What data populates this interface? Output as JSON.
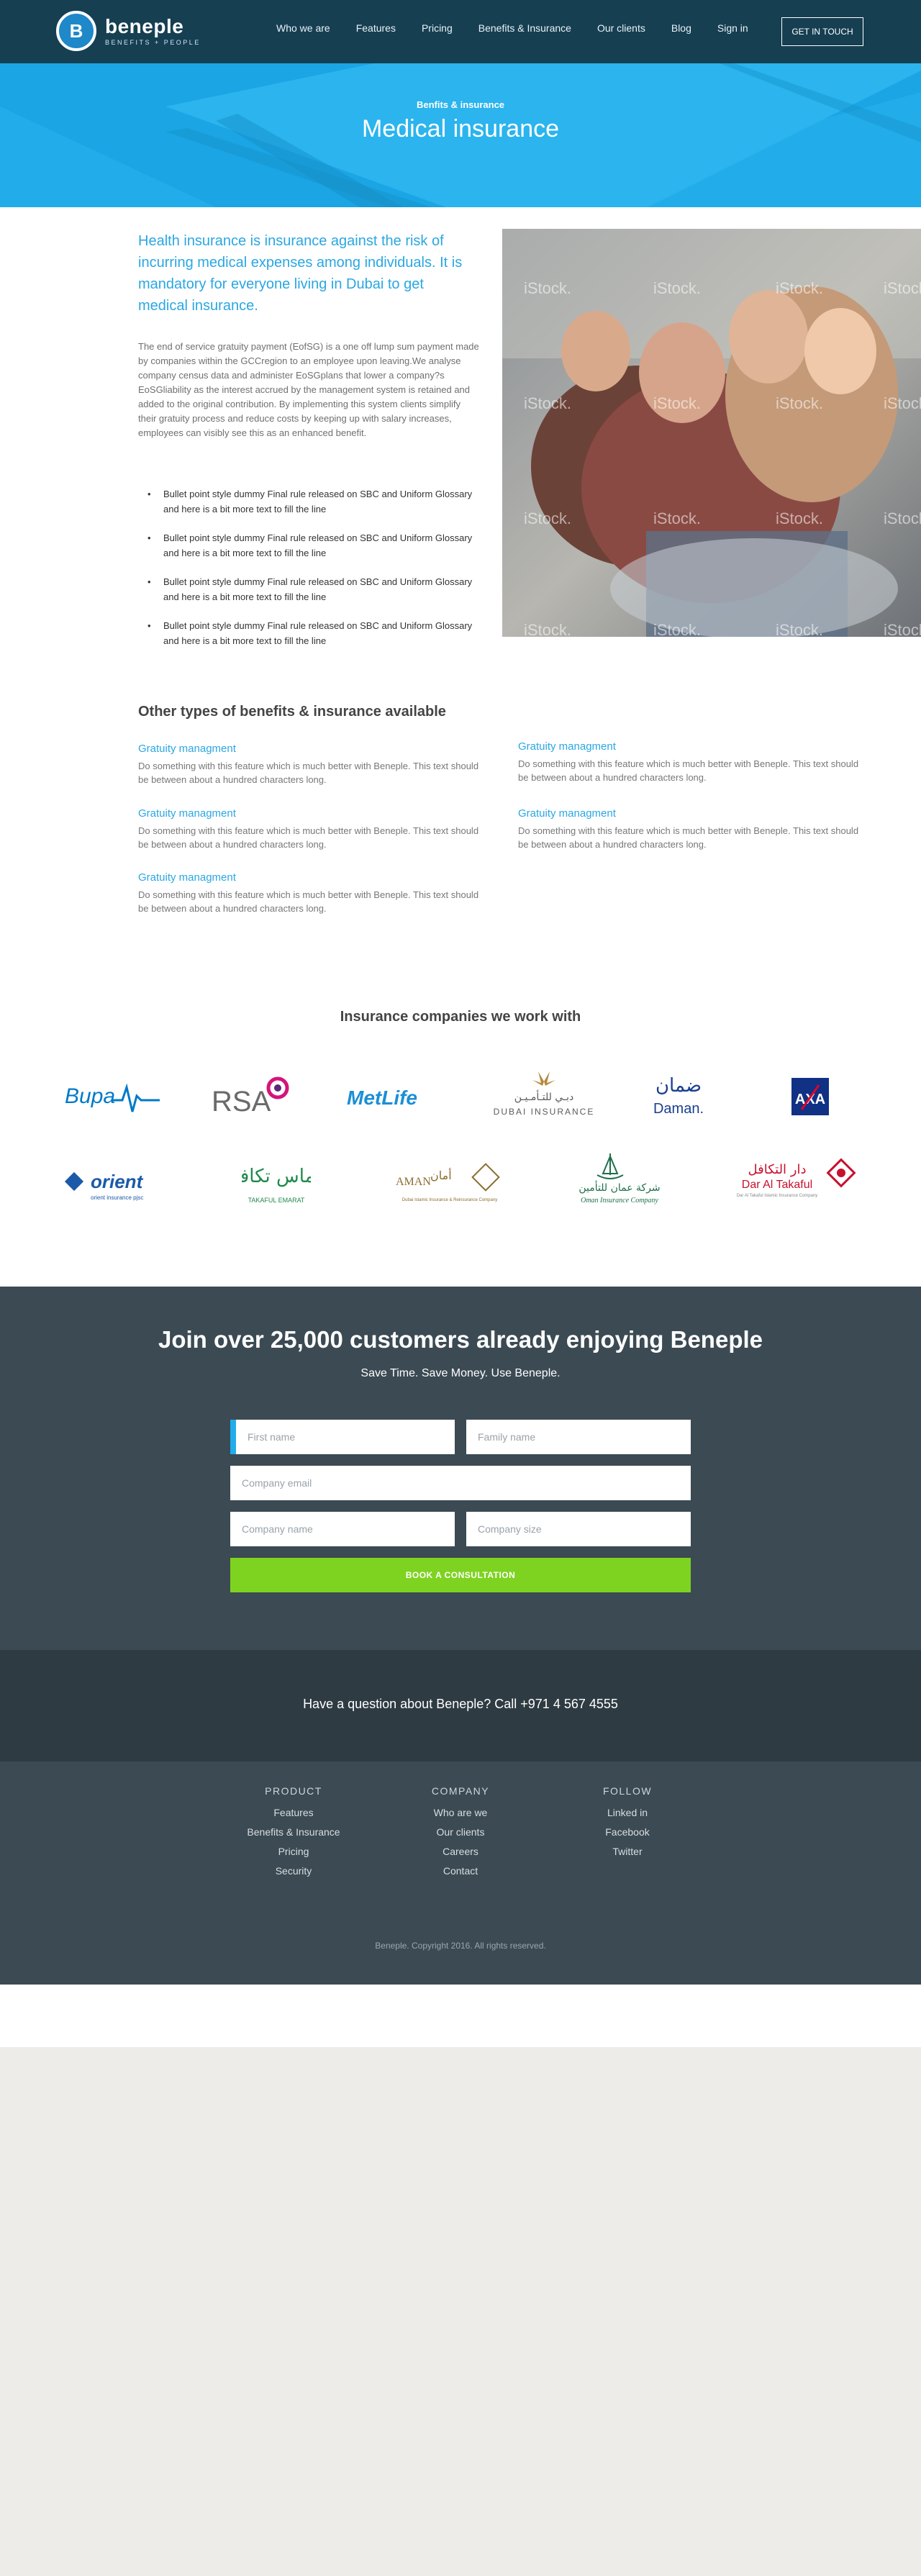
{
  "brand": {
    "name": "beneple",
    "tagline": "BENEFITS + PEOPLE",
    "logo_letter": "B"
  },
  "nav": {
    "items": [
      "Who we are",
      "Features",
      "Pricing",
      "Benefits & Insurance",
      "Our clients",
      "Blog",
      "Sign in"
    ],
    "cta": "GET IN TOUCH"
  },
  "hero": {
    "kicker": "Benfits & insurance",
    "title": "Medical insurance"
  },
  "intro": {
    "lead": "Health insurance is insurance against the risk of incurring medical expenses among individuals. It is mandatory for everyone living in Dubai to get medical insurance.",
    "body": "The end of service gratuity payment (EofSG) is a one off lump sum payment made by companies within the GCCregion to an employee upon leaving.We analyse company census data and administer EoSGplans that lower a company?s EoSGliability as the interest accrued by the management system is retained and added to the original contribution. By implementing this system clients simplify their gratuity process and reduce costs by keeping up with salary increases, employees can visibly see this as an enhanced benefit.",
    "bullets": [
      "Bullet point style dummy Final rule released on SBC and Uniform Glossary and here is a bit more text to fill the line",
      "Bullet point style dummy Final rule released on SBC and Uniform Glossary and here is a bit more text to fill the line",
      "Bullet point style dummy Final rule released on SBC and Uniform Glossary and here is a bit more text to fill the line",
      "Bullet point style dummy Final rule released on SBC and Uniform Glossary and here is a bit more text to fill the line"
    ],
    "photo_watermark": "iStock."
  },
  "types": {
    "title": "Other types of benefits & insurance available",
    "items": [
      {
        "title": "Gratuity managment",
        "text": "Do something with this feature which is much better with Beneple. This text should be between about a hundred characters long."
      },
      {
        "title": "Gratuity managment",
        "text": "Do something with this feature which is much better with Beneple. This text should be between about a hundred characters long."
      },
      {
        "title": "Gratuity managment",
        "text": "Do something with this feature which is much better with Beneple. This text should be between about a hundred characters long."
      },
      {
        "title": "Gratuity managment",
        "text": "Do something with this feature which is much better with Beneple. This text should be between about a hundred characters long."
      },
      {
        "title": "Gratuity managment",
        "text": "Do something with this feature which is much better with Beneple. This text should be between about a hundred characters long."
      }
    ]
  },
  "insurers": {
    "title": "Insurance companies we work with",
    "logos": {
      "bupa": "Bupa",
      "rsa": "RSA",
      "metlife": "MetLife",
      "dubai_ar": "دبـي للتـأمـيـن",
      "dubai": "DUBAI INSURANCE",
      "daman_ar": "ضمان",
      "daman": "Daman.",
      "axa": "AXA",
      "orient": "orient",
      "orient_sub": "orient insurance pjsc",
      "takaful_ar": "الماس تكافل",
      "takaful": "TAKAFUL EMARAT",
      "aman_ar": "أمان",
      "aman": "AMAN",
      "aman_sub": "Dubai Islamic Insurance & Reinsurance Company",
      "oman_ar": "شركة عمان للتأمين",
      "oman": "Oman Insurance Company",
      "daralt_ar": "دار التكافل",
      "daralt": "Dar Al Takaful",
      "daralt_sub": "Dar Al Takaful Islamic Insurance Company"
    },
    "colors": {
      "bupa": "#0079c8",
      "rsa": "#6a6a6a",
      "rsa_ring": "#d4147a",
      "metlife": "#1b8fd4",
      "dubai_gold": "#b58a3c",
      "daman": "#1a3f8f",
      "axa": "#103184",
      "axa_red": "#e4002b",
      "orient": "#1a5aa8",
      "takaful": "#1f8a4c",
      "aman": "#8a6d2f",
      "oman": "#1f6f4a",
      "daralt": "#c8102e"
    }
  },
  "join": {
    "title": "Join over 25,000 customers already enjoying Beneple",
    "subtitle": "Save Time. Save Money. Use Beneple.",
    "fields": {
      "first_name": "First name",
      "family_name": "Family name",
      "email": "Company email",
      "company_name": "Company name",
      "company_size": "Company size"
    },
    "button": "BOOK A CONSULTATION"
  },
  "question": "Have a question about Beneple? Call +971 4 567 4555",
  "footer": {
    "product": {
      "heading": "PRODUCT",
      "links": [
        "Features",
        "Benefits & Insurance",
        "Pricing",
        "Security"
      ]
    },
    "company": {
      "heading": "COMPANY",
      "links": [
        "Who are we",
        "Our clients",
        "Careers",
        "Contact"
      ]
    },
    "follow": {
      "heading": "FOLLOW",
      "links": [
        "Linked in",
        "Facebook",
        "Twitter"
      ]
    },
    "copyright": "Beneple. Copyright 2016. All rights reserved."
  },
  "colors": {
    "header": "#163f52",
    "hero": "#22acea",
    "accent": "#2aa7e2",
    "cta_green": "#7ed321",
    "dark": "#3b4a53",
    "darker": "#2f3b43"
  }
}
